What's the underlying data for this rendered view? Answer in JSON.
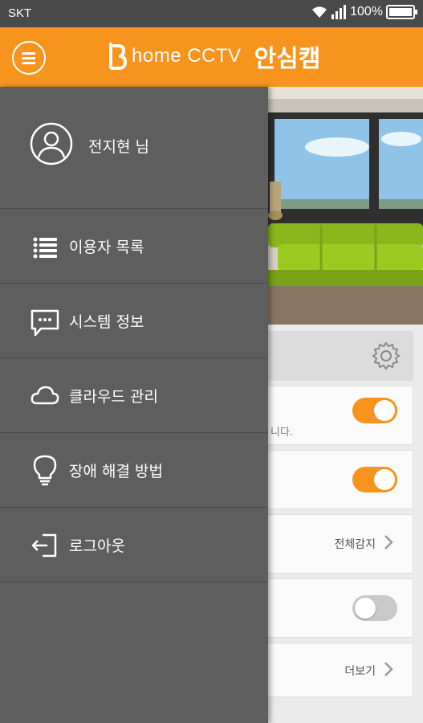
{
  "status_bar": {
    "carrier": "SKT",
    "battery": "100%"
  },
  "header": {
    "brand_logo": "B",
    "brand_en": "home CCTV",
    "brand_ko": "안심캠"
  },
  "drawer": {
    "user_name": "전지현 님",
    "items": [
      {
        "label": "이용자 목록",
        "icon": "list-icon"
      },
      {
        "label": "시스템 정보",
        "icon": "chat-bubble-icon"
      },
      {
        "label": "클라우드 관리",
        "icon": "cloud-icon"
      },
      {
        "label": "장애 해결 방법",
        "icon": "lightbulb-icon"
      },
      {
        "label": "로그아웃",
        "icon": "logout-icon"
      }
    ]
  },
  "background": {
    "notice_fragment": "니다.",
    "detect_value": "전체감지",
    "more_label": "더보기",
    "toggles": [
      true,
      true,
      false
    ]
  },
  "colors": {
    "accent": "#f7941d",
    "drawer": "#5e5e5e",
    "status_bar": "#4a4a4a"
  }
}
